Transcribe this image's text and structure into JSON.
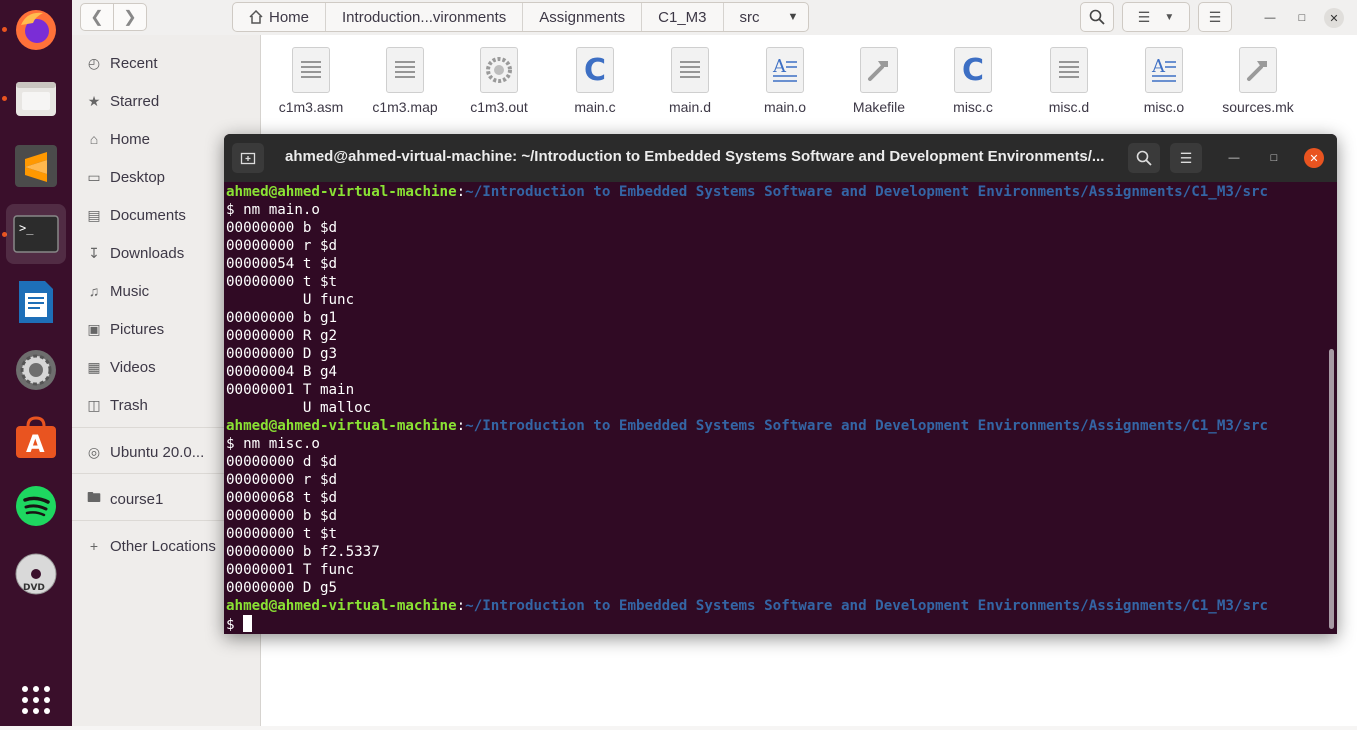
{
  "dock": {
    "apps": [
      "firefox-icon",
      "files-icon",
      "sublime-text-icon",
      "terminal-icon",
      "libreoffice-writer-icon",
      "settings-icon",
      "software-center-icon",
      "spotify-icon",
      "dvd-icon",
      "show-apps-icon"
    ]
  },
  "files": {
    "breadcrumbs": [
      "Home",
      "Introduction...vironments",
      "Assignments",
      "C1_M3",
      "src"
    ],
    "sidebar": [
      {
        "label": "Recent",
        "icon": "clock-icon"
      },
      {
        "label": "Starred",
        "icon": "star-icon"
      },
      {
        "label": "Home",
        "icon": "home-icon"
      },
      {
        "label": "Desktop",
        "icon": "desktop-icon"
      },
      {
        "label": "Documents",
        "icon": "document-icon"
      },
      {
        "label": "Downloads",
        "icon": "download-icon"
      },
      {
        "label": "Music",
        "icon": "music-icon"
      },
      {
        "label": "Pictures",
        "icon": "picture-icon"
      },
      {
        "label": "Videos",
        "icon": "video-icon"
      },
      {
        "label": "Trash",
        "icon": "trash-icon"
      },
      {
        "label": "Ubuntu 20.0...",
        "icon": "disc-icon"
      },
      {
        "label": "course1",
        "icon": "folder-icon"
      },
      {
        "label": "Other Locations",
        "icon": "plus-icon"
      }
    ],
    "items": [
      {
        "name": "c1m3.asm",
        "type": "text"
      },
      {
        "name": "c1m3.map",
        "type": "text"
      },
      {
        "name": "c1m3.out",
        "type": "exec"
      },
      {
        "name": "main.c",
        "type": "c"
      },
      {
        "name": "main.d",
        "type": "text"
      },
      {
        "name": "main.o",
        "type": "obj"
      },
      {
        "name": "Makefile",
        "type": "make"
      },
      {
        "name": "misc.c",
        "type": "c"
      },
      {
        "name": "misc.d",
        "type": "text"
      },
      {
        "name": "misc.o",
        "type": "obj"
      },
      {
        "name": "sources.mk",
        "type": "make"
      }
    ]
  },
  "terminal": {
    "title": "ahmed@ahmed-virtual-machine: ~/Introduction to Embedded Systems Software and Development Environments/...",
    "prompt_user": "ahmed@ahmed-virtual-machine",
    "prompt_path": "~/Introduction to Embedded Systems Software and Development Environments/Assignments/C1_M3/src",
    "lines": [
      {
        "kind": "prompt"
      },
      {
        "kind": "text",
        "text": "$ nm main.o"
      },
      {
        "kind": "text",
        "text": "00000000 b $d"
      },
      {
        "kind": "text",
        "text": "00000000 r $d"
      },
      {
        "kind": "text",
        "text": "00000054 t $d"
      },
      {
        "kind": "text",
        "text": "00000000 t $t"
      },
      {
        "kind": "text",
        "text": "         U func"
      },
      {
        "kind": "text",
        "text": "00000000 b g1"
      },
      {
        "kind": "text",
        "text": "00000000 R g2"
      },
      {
        "kind": "text",
        "text": "00000000 D g3"
      },
      {
        "kind": "text",
        "text": "00000004 B g4"
      },
      {
        "kind": "text",
        "text": "00000001 T main"
      },
      {
        "kind": "text",
        "text": "         U malloc"
      },
      {
        "kind": "prompt"
      },
      {
        "kind": "text",
        "text": "$ nm misc.o"
      },
      {
        "kind": "text",
        "text": "00000000 d $d"
      },
      {
        "kind": "text",
        "text": "00000000 r $d"
      },
      {
        "kind": "text",
        "text": "00000068 t $d"
      },
      {
        "kind": "text",
        "text": "00000000 b $d"
      },
      {
        "kind": "text",
        "text": "00000000 t $t"
      },
      {
        "kind": "text",
        "text": "00000000 b f2.5337"
      },
      {
        "kind": "text",
        "text": "00000001 T func"
      },
      {
        "kind": "text",
        "text": "00000000 D g5"
      },
      {
        "kind": "prompt"
      },
      {
        "kind": "input",
        "text": "$ "
      }
    ]
  },
  "colors": {
    "terminal_bg": "#300a24",
    "prompt_user": "#8ae234",
    "prompt_path": "#3465a4",
    "dock_bg": "#3a0f2b",
    "accent": "#e95420"
  }
}
